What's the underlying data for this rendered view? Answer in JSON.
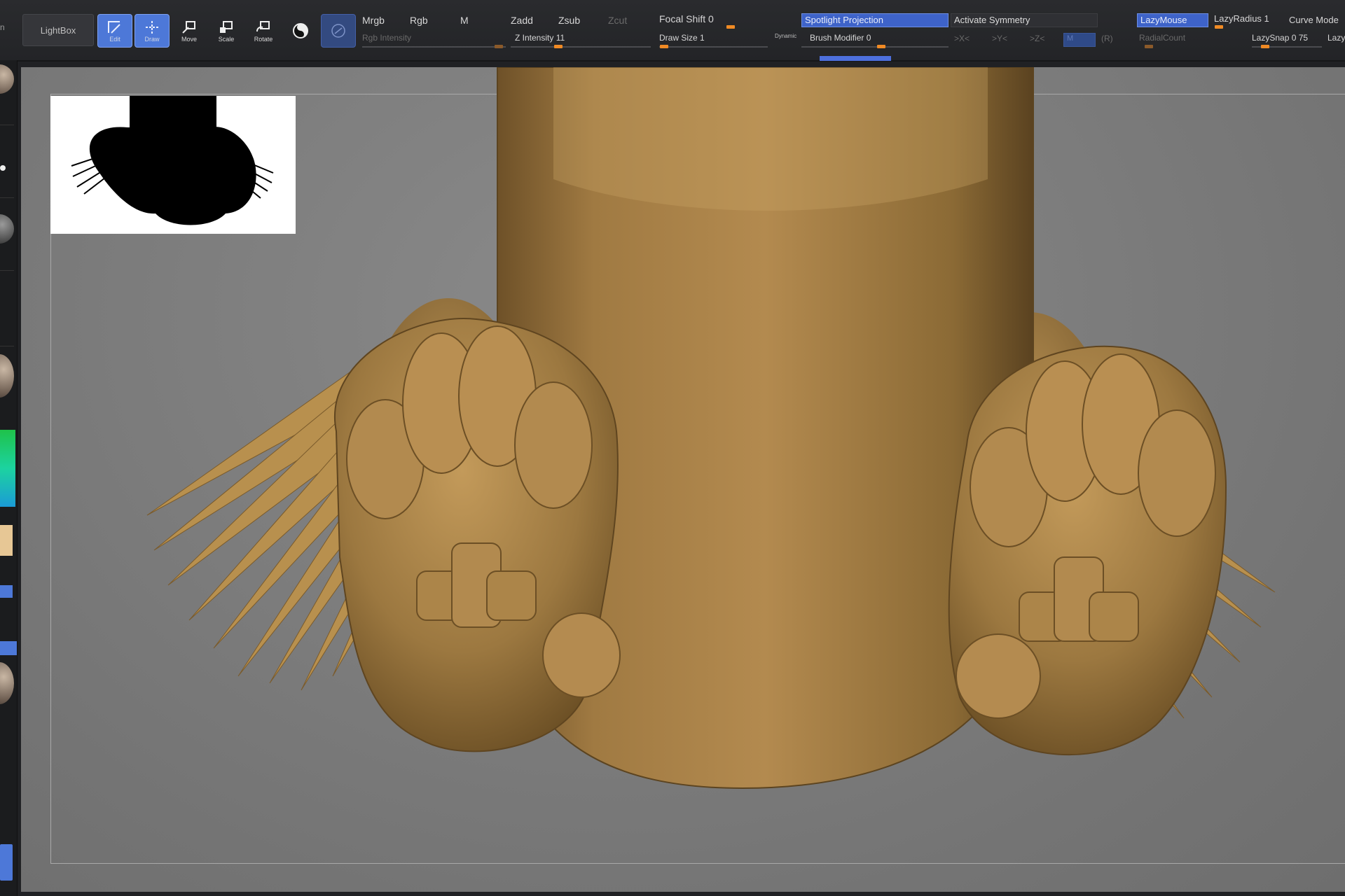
{
  "toolbar": {
    "lightbox_label": "LightBox",
    "buttons": [
      {
        "id": "edit",
        "label": "Edit",
        "active": true
      },
      {
        "id": "draw",
        "label": "Draw",
        "active": true
      },
      {
        "id": "move",
        "label": "Move",
        "active": false
      },
      {
        "id": "scale",
        "label": "Scale",
        "active": false
      },
      {
        "id": "rotate",
        "label": "Rotate",
        "active": false
      }
    ],
    "mrgb": "Mrgb",
    "rgb": "Rgb",
    "m": "M",
    "rgb_intensity": "Rgb Intensity",
    "zadd": "Zadd",
    "zsub": "Zsub",
    "zcut": "Zcut",
    "z_intensity": "Z Intensity 11",
    "focal_shift": "Focal Shift 0",
    "draw_size": "Draw Size 1",
    "dynamic": "Dynamic",
    "spotlight_projection": "Spotlight Projection",
    "brush_modifier": "Brush Modifier 0",
    "activate_symmetry": "Activate Symmetry",
    "sym_x": ">X<",
    "sym_y": ">Y<",
    "sym_z": ">Z<",
    "sym_m": "M",
    "sym_r": "(R)",
    "radial_count": "RadialCount",
    "lazymouse": "LazyMouse",
    "lazy_radius": "LazyRadius 1",
    "lazy_snap": "LazySnap 0 75",
    "curve_mode": "Curve Mode",
    "lazy_step": "Lazy"
  },
  "colors": {
    "accent_blue": "#4d78d8",
    "slider_orange": "#f08a24",
    "clay": "#a98148",
    "viewport_gray": "#7a7a7a"
  },
  "viewport": {
    "reference_image": "silhouette-thumbnail",
    "model": "sculpted-clay-character-feet"
  }
}
